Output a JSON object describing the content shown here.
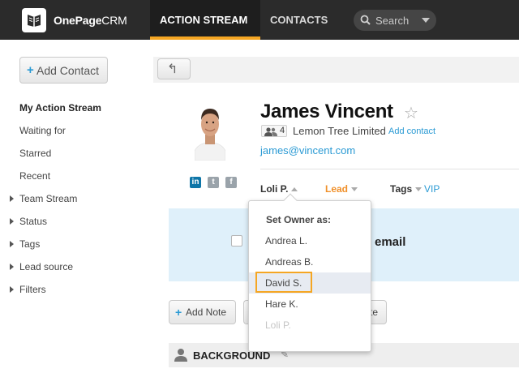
{
  "header": {
    "brand_bold": "OnePage",
    "brand_light": "CRM",
    "nav_action_stream": "ACTION STREAM",
    "nav_contacts": "CONTACTS",
    "search_placeholder": "Search",
    "accent_color": "#f5a623"
  },
  "sidebar": {
    "add_contact_plus": "+",
    "add_contact_label": "Add Contact",
    "items": [
      {
        "label": "My Action Stream",
        "active": true,
        "expandable": false
      },
      {
        "label": "Waiting for",
        "active": false,
        "expandable": false
      },
      {
        "label": "Starred",
        "active": false,
        "expandable": false
      },
      {
        "label": "Recent",
        "active": false,
        "expandable": false
      },
      {
        "label": "Team Stream",
        "active": false,
        "expandable": true
      },
      {
        "label": "Status",
        "active": false,
        "expandable": true
      },
      {
        "label": "Tags",
        "active": false,
        "expandable": true
      },
      {
        "label": "Lead source",
        "active": false,
        "expandable": true
      },
      {
        "label": "Filters",
        "active": false,
        "expandable": true
      }
    ]
  },
  "toolbar": {
    "back_icon": "↰"
  },
  "contact": {
    "name": "James Vincent",
    "star_icon": "☆",
    "people_count": "4",
    "company": "Lemon Tree Limited",
    "add_contact_link": "Add contact",
    "email": "james@vincent.com",
    "owner": "Loli P.",
    "status": "Lead",
    "tags_label": "Tags",
    "tag_vip": "VIP",
    "social": [
      {
        "icon": "linkedin-icon",
        "glyph": "in",
        "color": "#0e76a8"
      },
      {
        "icon": "twitter-icon",
        "glyph": "t",
        "color": "#9aa3aa"
      },
      {
        "icon": "facebook-icon",
        "glyph": "f",
        "color": "#9aa3aa"
      }
    ]
  },
  "panel": {
    "email_word": "email",
    "background_color": "#dff0fa"
  },
  "actions": {
    "add_note_plus": "+",
    "add_note_label": "Add Note",
    "partial_button_tail": "te"
  },
  "background_section": {
    "title": "BACKGROUND",
    "pencil_icon": "✎"
  },
  "owner_dropdown": {
    "title": "Set Owner as:",
    "options": [
      {
        "label": "Andrea L.",
        "state": "normal"
      },
      {
        "label": "Andreas B.",
        "state": "normal"
      },
      {
        "label": "David S.",
        "state": "highlighted"
      },
      {
        "label": "Hare K.",
        "state": "normal"
      },
      {
        "label": "Loli P.",
        "state": "disabled"
      }
    ]
  }
}
